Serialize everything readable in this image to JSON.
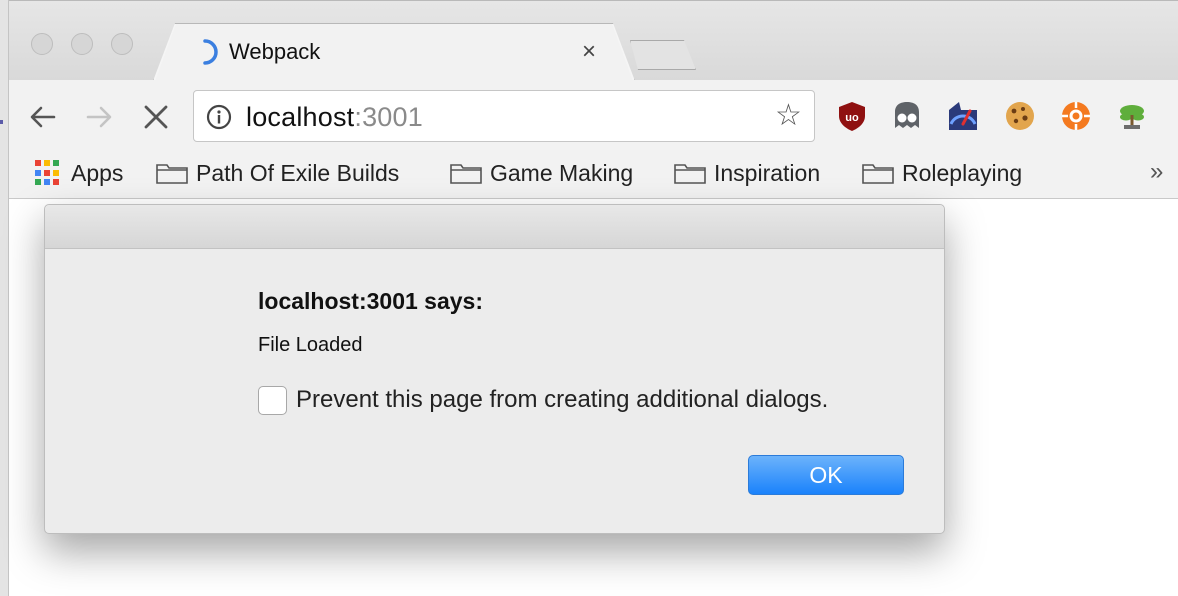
{
  "browser": {
    "tab": {
      "title": "Webpack",
      "close_glyph": "×"
    },
    "address_bar": {
      "host": "localhost",
      "port": ":3001"
    },
    "bookmarks": [
      {
        "label": "Apps",
        "icon": "apps-grid-icon"
      },
      {
        "label": "Path Of Exile Builds",
        "icon": "folder-icon"
      },
      {
        "label": "Game Making",
        "icon": "folder-icon"
      },
      {
        "label": "Inspiration",
        "icon": "folder-icon"
      },
      {
        "label": "Roleplaying",
        "icon": "folder-icon"
      }
    ],
    "overflow_glyph": "»",
    "extensions": [
      "ublock-icon",
      "ghostery-icon",
      "speed-test-icon",
      "cookie-icon",
      "lifebuoy-icon",
      "bonsai-icon"
    ]
  },
  "dialog": {
    "title": "localhost:3001 says:",
    "message": "File Loaded",
    "checkbox_label": "Prevent this page from creating additional dialogs.",
    "checkbox_checked": false,
    "ok_label": "OK"
  },
  "colors": {
    "accent": "#1a82fb",
    "ublock": "#8f1111"
  }
}
